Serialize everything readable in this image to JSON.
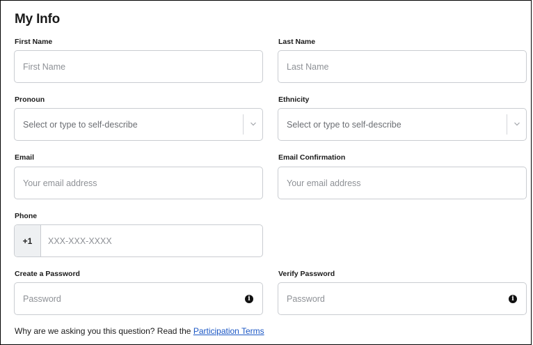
{
  "title": "My Info",
  "fields": {
    "first_name": {
      "label": "First Name",
      "placeholder": "First Name"
    },
    "last_name": {
      "label": "Last Name",
      "placeholder": "Last Name"
    },
    "pronoun": {
      "label": "Pronoun",
      "placeholder": "Select or type to self-describe"
    },
    "ethnicity": {
      "label": "Ethnicity",
      "placeholder": "Select or type to self-describe"
    },
    "email": {
      "label": "Email",
      "placeholder": "Your email address"
    },
    "email_confirm": {
      "label": "Email Confirmation",
      "placeholder": "Your email address"
    },
    "phone": {
      "label": "Phone",
      "prefix": "+1",
      "placeholder": "XXX-XXX-XXXX"
    },
    "password": {
      "label": "Create a Password",
      "placeholder": "Password"
    },
    "verify_password": {
      "label": "Verify Password",
      "placeholder": "Password"
    }
  },
  "footer": {
    "text": "Why are we asking you this question? Read the ",
    "link": "Participation Terms"
  },
  "icons": {
    "select_arrow": "chevron-down-icon",
    "password_info": "info-icon"
  }
}
